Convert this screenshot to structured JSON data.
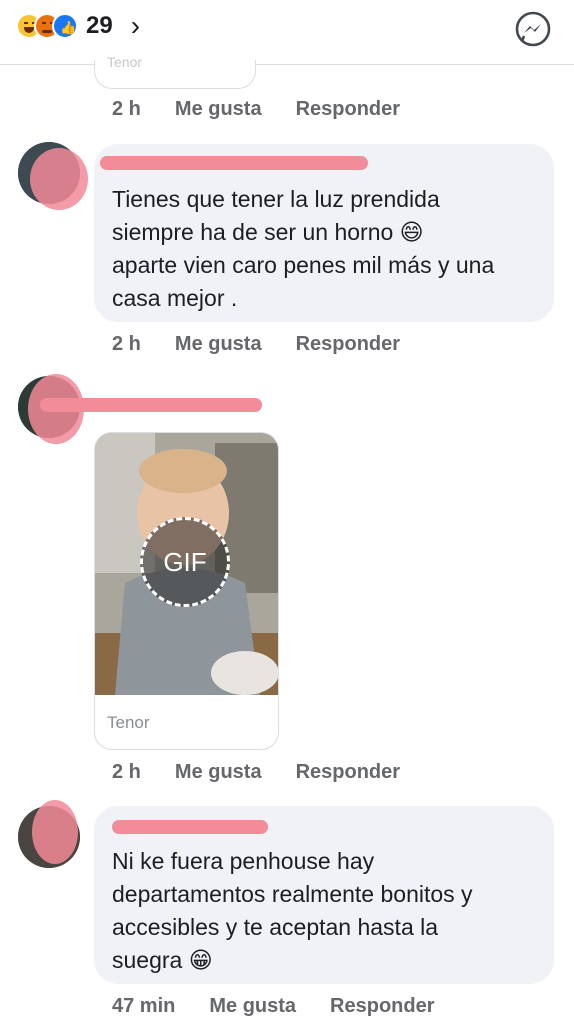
{
  "header": {
    "reaction_count": "29",
    "chevron": "›",
    "reactions": [
      "haha",
      "angry",
      "like"
    ],
    "messenger_icon": "messenger-icon"
  },
  "top_partial": {
    "label": "Tenor"
  },
  "meta_labels": {
    "like": "Me gusta",
    "reply": "Responder"
  },
  "comments": [
    {
      "time": "2 h"
    },
    {
      "text_lines": [
        "Tienes que tener la luz prendida",
        "siempre ha de ser un horno 😄",
        "aparte vien caro penes mil más y una",
        "casa mejor ."
      ],
      "time": "2 h"
    },
    {
      "gif_badge": "GIF",
      "gif_source": "Tenor",
      "time": "2 h"
    },
    {
      "text_lines": [
        "Ni ke fuera penhouse hay",
        "departamentos realmente bonitos y",
        "accesibles y te aceptan hasta la",
        "suegra 😁"
      ],
      "time": "47 min"
    }
  ]
}
